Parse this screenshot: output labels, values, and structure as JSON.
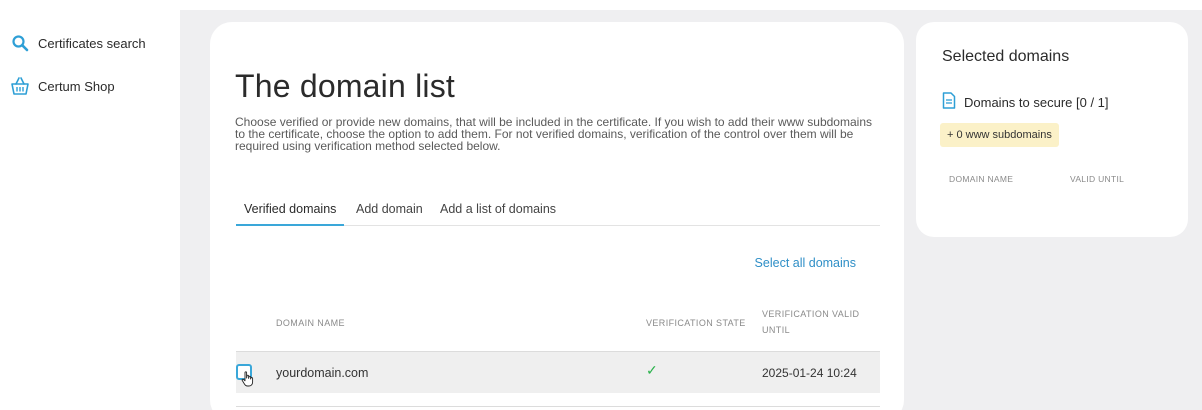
{
  "sidebar": {
    "items": [
      {
        "label": "Certificates search",
        "icon": "search-icon"
      },
      {
        "label": "Certum Shop",
        "icon": "basket-icon"
      }
    ]
  },
  "main": {
    "title": "The domain list",
    "description": "Choose verified or provide new domains, that will be included in the certificate. If you wish to add their www subdomains to the certificate, choose the option to add them. For not verified domains, verification of the control over them will be required using verification method selected below.",
    "tabs": [
      {
        "label": "Verified domains",
        "active": true
      },
      {
        "label": "Add domain",
        "active": false
      },
      {
        "label": "Add a list of domains",
        "active": false
      }
    ],
    "select_all_label": "Select all domains",
    "table": {
      "headers": {
        "domain_name": "DOMAIN NAME",
        "verification_state": "VERIFICATION STATE",
        "verification_valid_until": "VERIFICATION VALID UNTIL"
      },
      "rows": [
        {
          "domain": "yourdomain.com",
          "verification_state": "✓",
          "valid_until": "2025-01-24 10:24"
        }
      ]
    }
  },
  "side": {
    "title": "Selected domains",
    "secure_label": "Domains to secure [0 / 1]",
    "www_badge": "+ 0 www subdomains",
    "headers": {
      "domain_name": "DOMAIN NAME",
      "valid_until": "VALID UNTIL"
    }
  },
  "colors": {
    "accent": "#3aa7d9",
    "link": "#2f8fc7",
    "success": "#2bb24c",
    "badge_bg": "#fbf1c8",
    "page_bg": "#efeff1"
  }
}
